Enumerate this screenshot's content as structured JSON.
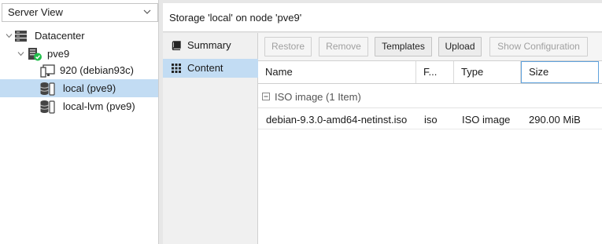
{
  "view_selector": {
    "value": "Server View"
  },
  "tree": {
    "datacenter": "Datacenter",
    "node": "pve9",
    "items": [
      {
        "label": "920 (debian93c)"
      },
      {
        "label": "local (pve9)"
      },
      {
        "label": "local-lvm (pve9)"
      }
    ]
  },
  "panel_title": "Storage 'local' on node 'pve9'",
  "menu": {
    "summary": "Summary",
    "content": "Content"
  },
  "toolbar": {
    "restore": "Restore",
    "remove": "Remove",
    "templates": "Templates",
    "upload": "Upload",
    "show_config": "Show Configuration"
  },
  "grid": {
    "columns": {
      "name": "Name",
      "format": "F...",
      "type": "Type",
      "size": "Size"
    },
    "group_label": "ISO image (1 Item)",
    "rows": [
      {
        "name": "debian-9.3.0-amd64-netinst.iso",
        "format": "iso",
        "type": "ISO image",
        "size": "290.00 MiB"
      }
    ]
  },
  "colors": {
    "selection": "#c2dcf3",
    "focus_border": "#5fa2dd",
    "running_green": "#21bf4b"
  }
}
